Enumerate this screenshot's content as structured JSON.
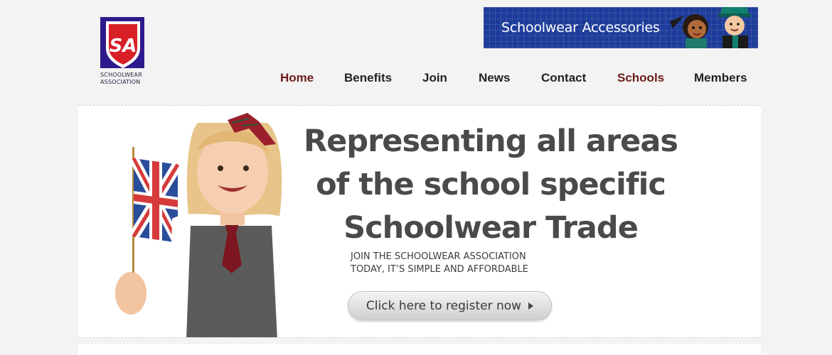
{
  "header": {
    "logo": {
      "monogram": "SA",
      "line1": "SCHOOLWEAR",
      "line2": "ASSOCIATION"
    },
    "banner": {
      "text": "Schoolwear Accessories"
    }
  },
  "nav": {
    "items": [
      {
        "label": "Home",
        "color": "#6e1b1b"
      },
      {
        "label": "Benefits",
        "color": "#222222"
      },
      {
        "label": "Join",
        "color": "#222222"
      },
      {
        "label": "News",
        "color": "#222222"
      },
      {
        "label": "Contact",
        "color": "#222222"
      },
      {
        "label": "Schools",
        "color": "#6e1b1b"
      },
      {
        "label": "Members",
        "color": "#222222"
      }
    ]
  },
  "hero": {
    "headline": [
      "Representing all areas",
      "of the school specific",
      "Schoolwear Trade"
    ],
    "subtext": [
      "JOIN THE SCHOOLWEAR ASSOCIATION",
      "TODAY, IT’S SIMPLE AND AFFORDABLE"
    ],
    "cta_label": "Click here to register now"
  },
  "colors": {
    "page_background": "#f3f3f3",
    "nav_accent": "#6e1b1b",
    "banner_blue": "#1d3c9a",
    "logo_red": "#d81f26",
    "logo_purple": "#2e1a8c"
  }
}
